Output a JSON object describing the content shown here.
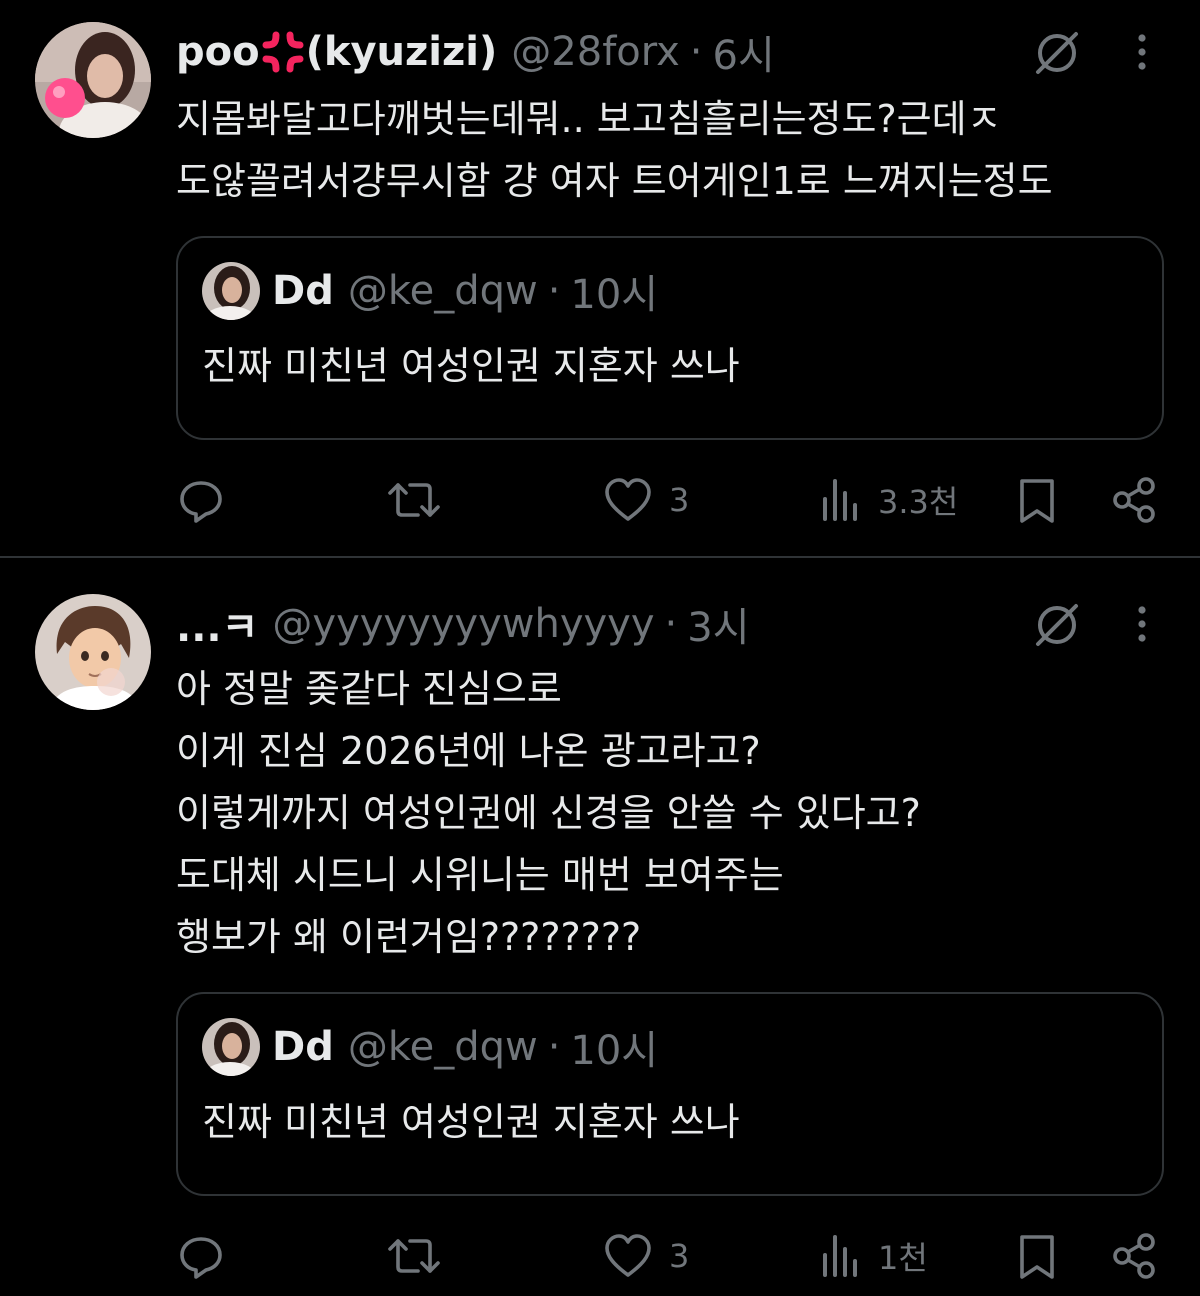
{
  "tweets": [
    {
      "display_name": "poo",
      "display_name_suffix": "(kyuzizi)",
      "handle": "@28forx",
      "separator": "·",
      "time": "6시",
      "text": "지몸봐달고다깨벗는데뭐.. 보고침흘리는정도?근데ㅈ\n도않꼴려서걍무시함 걍 여자 트어게인1로 느껴지는정도",
      "quote": {
        "display_name": "Dd",
        "handle": "@ke_dqw",
        "separator": "·",
        "time": "10시",
        "text": "진짜 미친년 여성인권 지혼자 쓰나"
      },
      "actions": {
        "replies": "",
        "reposts": "",
        "likes": "3",
        "views": "3.3천"
      }
    },
    {
      "display_name": "...ㅋ",
      "display_name_suffix": "",
      "handle": "@yyyyyyyywhyyyy",
      "separator": "·",
      "time": "3시",
      "text": "아 정말 좆같다 진심으로\n이게 진심 2026년에 나온 광고라고?\n이렇게까지 여성인권에 신경을 안쓸 수 있다고?\n도대체 시드니 시위니는 매번 보여주는\n행보가 왜 이런거임????????",
      "quote": {
        "display_name": "Dd",
        "handle": "@ke_dqw",
        "separator": "·",
        "time": "10시",
        "text": "진짜 미친년 여성인권 지혼자 쓰나"
      },
      "actions": {
        "replies": "",
        "reposts": "",
        "likes": "3",
        "views": "1천"
      }
    }
  ],
  "icons": {
    "reply": "reply-icon",
    "repost": "repost-icon",
    "like": "heart-icon",
    "views": "views-icon",
    "bookmark": "bookmark-icon",
    "share": "share-icon",
    "grok": "grok-icon",
    "more": "more-icon",
    "anger": "anger-emoji-icon"
  },
  "colors": {
    "background": "#000000",
    "text": "#e7e9ea",
    "muted": "#71767b",
    "border": "#2f3336",
    "anger_emoji": "#f4245e"
  }
}
